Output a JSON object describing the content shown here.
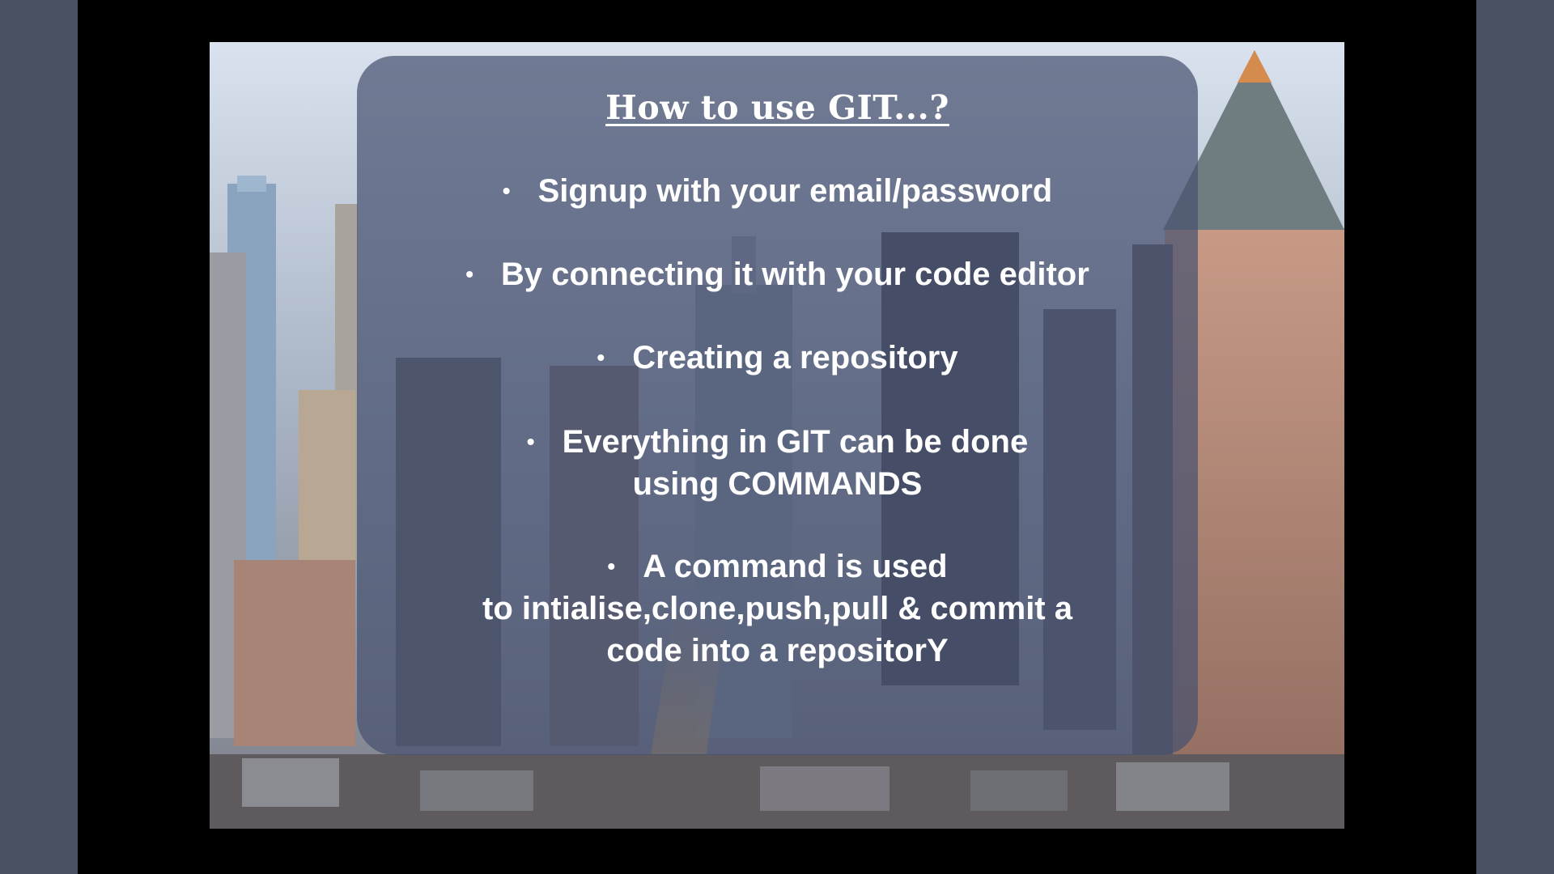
{
  "slide": {
    "title": "How to use GIT...?",
    "bullets": [
      {
        "bullet_char": "•",
        "lines": [
          "Signup with your email/password"
        ]
      },
      {
        "bullet_char": "•",
        "lines": [
          "By connecting it with your code editor"
        ]
      },
      {
        "bullet_char": "•",
        "lines": [
          "Creating a repository"
        ]
      },
      {
        "bullet_char": "•",
        "lines": [
          "Everything in GIT can be done",
          "using COMMANDS"
        ]
      },
      {
        "bullet_char": "•",
        "lines": [
          "A command is used",
          "to intialise,clone,push,pull & commit a",
          "code into a repositorY"
        ]
      }
    ]
  },
  "colors": {
    "letterbox": "#000000",
    "window_bg": "#4a5160",
    "panel": "#485270",
    "text": "#ffffff"
  }
}
